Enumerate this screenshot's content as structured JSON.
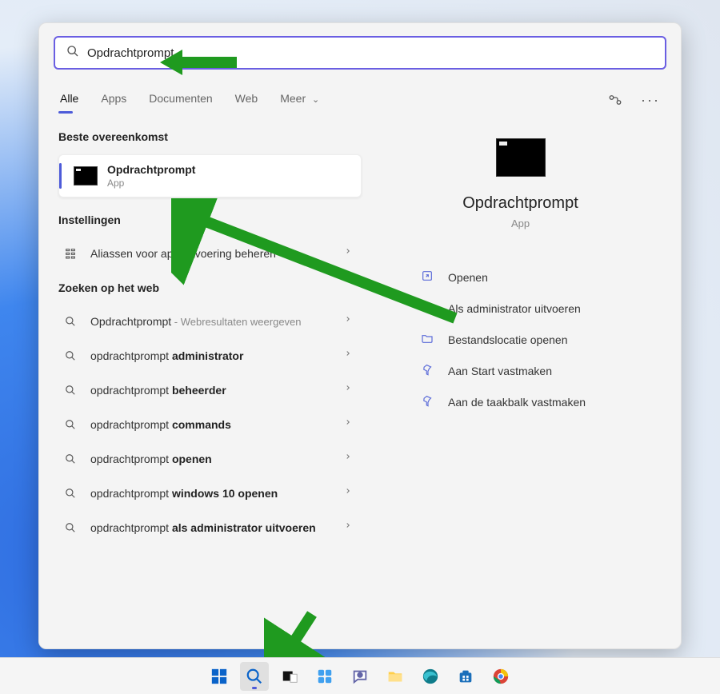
{
  "search": {
    "value": "Opdrachtprompt"
  },
  "tabs": {
    "all": "Alle",
    "apps": "Apps",
    "docs": "Documenten",
    "web": "Web",
    "more": "Meer"
  },
  "left": {
    "best_match_header": "Beste overeenkomst",
    "best_match": {
      "title": "Opdrachtprompt",
      "subtitle": "App"
    },
    "settings_header": "Instellingen",
    "settings_item": {
      "title": "Aliassen voor app-uitvoering beheren"
    },
    "web_header": "Zoeken op het web",
    "web_items": [
      {
        "prefix": "Opdrachtprompt",
        "suffix": " - Webresultaten weergeven",
        "bold_suffix": ""
      },
      {
        "prefix": "opdrachtprompt ",
        "bold_suffix": "administrator"
      },
      {
        "prefix": "opdrachtprompt ",
        "bold_suffix": "beheerder"
      },
      {
        "prefix": "opdrachtprompt ",
        "bold_suffix": "commands"
      },
      {
        "prefix": "opdrachtprompt ",
        "bold_suffix": "openen"
      },
      {
        "prefix": "opdrachtprompt ",
        "bold_suffix": "windows 10 openen"
      },
      {
        "prefix": "opdrachtprompt ",
        "bold_suffix": "als administrator uitvoeren"
      }
    ]
  },
  "preview": {
    "title": "Opdrachtprompt",
    "subtitle": "App"
  },
  "actions": {
    "open": "Openen",
    "admin": "Als administrator uitvoeren",
    "location": "Bestandslocatie openen",
    "pin_start": "Aan Start vastmaken",
    "pin_taskbar": "Aan de taakbalk vastmaken"
  }
}
